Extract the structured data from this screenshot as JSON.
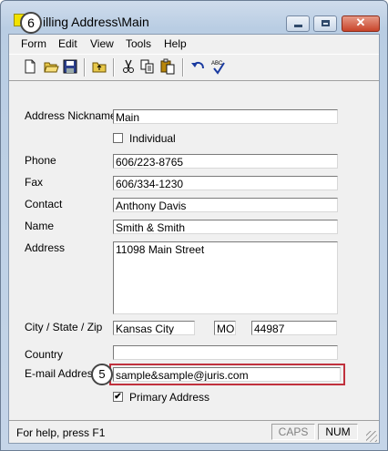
{
  "window": {
    "title": "Billing Address\\Main",
    "title_visible": "illing Address\\Main"
  },
  "annotations": {
    "badge_title": "6",
    "badge_email": "5"
  },
  "menu": {
    "items": [
      "Form",
      "Edit",
      "View",
      "Tools",
      "Help"
    ]
  },
  "toolbar": {
    "icons": [
      "new-icon",
      "open-icon",
      "save-icon",
      "up-folder-icon",
      "cut-icon",
      "copy-icon",
      "paste-icon",
      "undo-icon",
      "spellcheck-icon"
    ]
  },
  "form": {
    "nickname": {
      "label": "Address Nickname",
      "value": "Main"
    },
    "individual": {
      "label": "Individual",
      "checked": false
    },
    "phone": {
      "label": "Phone",
      "value": "606/223-8765"
    },
    "fax": {
      "label": "Fax",
      "value": "606/334-1230"
    },
    "contact": {
      "label": "Contact",
      "value": "Anthony Davis"
    },
    "name": {
      "label": "Name",
      "value": "Smith & Smith"
    },
    "address": {
      "label": "Address",
      "value": "11098 Main Street"
    },
    "city_state_zip": {
      "label": "City / State / Zip",
      "city": "Kansas City",
      "state": "MO",
      "zip": "44987"
    },
    "country": {
      "label": "Country",
      "value": ""
    },
    "email": {
      "label": "E-mail Address",
      "value": "sample&sample@juris.com"
    },
    "primary": {
      "label": "Primary Address",
      "checked": true,
      "mark": "✔"
    }
  },
  "status": {
    "help": "For help, press F1",
    "caps": "CAPS",
    "num": "NUM"
  },
  "colors": {
    "highlight": "#c0313d",
    "caps_disabled": "#808080"
  }
}
